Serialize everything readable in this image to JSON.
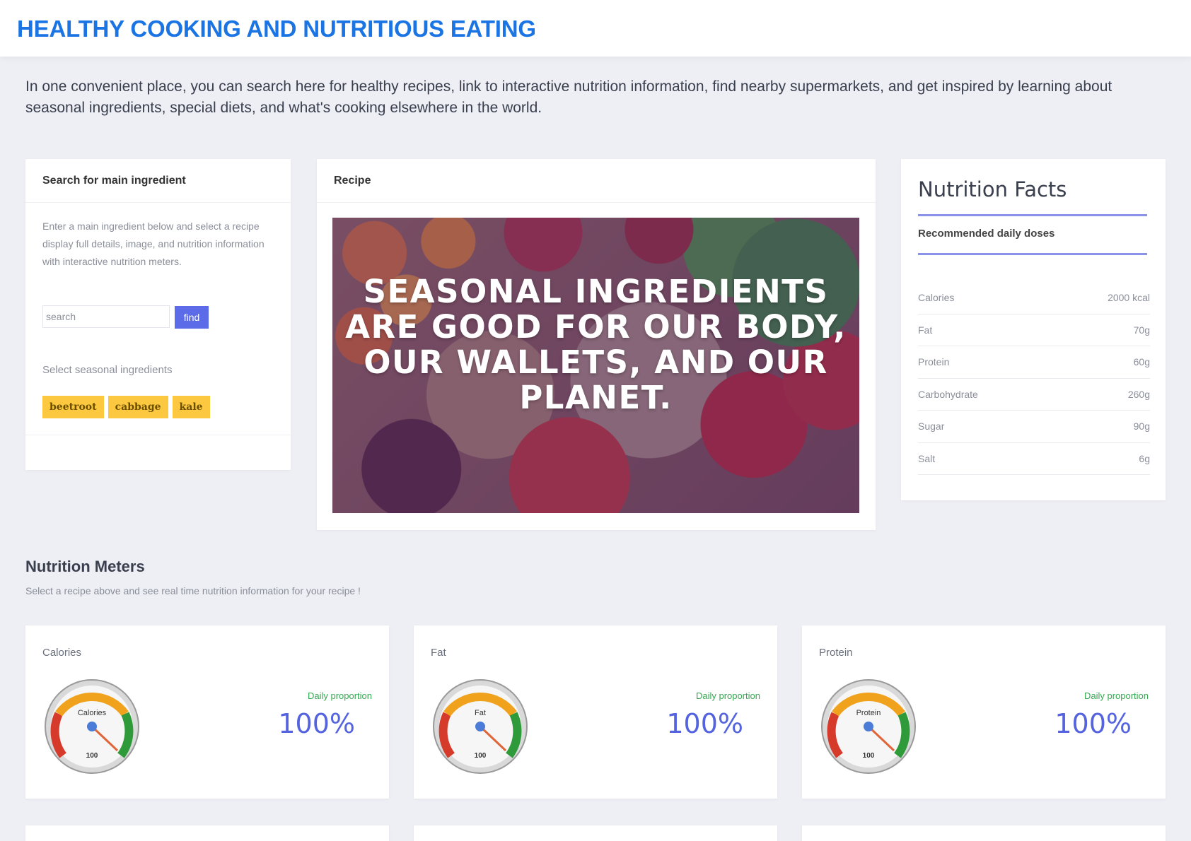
{
  "header": {
    "title": "HEALTHY COOKING AND NUTRITIOUS EATING"
  },
  "intro": "In one convenient place, you can search here for healthy recipes, link to interactive nutrition information, find nearby supermarkets, and get inspired by learning about seasonal ingredients, special diets, and what's cooking elsewhere in the world.",
  "search_card": {
    "title": "Search for main ingredient",
    "description": "Enter a main ingredient below and select a recipe display full details, image, and nutrition information with interactive nutrition meters.",
    "search_placeholder": "search",
    "find_label": "find",
    "seasonal_label": "Select seasonal ingredients",
    "chips": [
      "beetroot",
      "cabbage",
      "kale"
    ]
  },
  "recipe_card": {
    "title": "Recipe",
    "image_text": "SEASONAL INGREDIENTS ARE GOOD FOR OUR BODY, OUR WALLETS, AND OUR PLANET."
  },
  "facts_card": {
    "title": "Nutrition Facts",
    "subtitle": "Recommended daily doses",
    "rows": [
      {
        "label": "Calories",
        "value": "2000 kcal"
      },
      {
        "label": "Fat",
        "value": "70g"
      },
      {
        "label": "Protein",
        "value": "60g"
      },
      {
        "label": "Carbohydrate",
        "value": "260g"
      },
      {
        "label": "Sugar",
        "value": "90g"
      },
      {
        "label": "Salt",
        "value": "6g"
      }
    ]
  },
  "meters": {
    "title": "Nutrition Meters",
    "subtitle": "Select a recipe above and see real time nutrition information for your recipe !",
    "daily_label": "Daily proportion",
    "cards": [
      {
        "name": "Calories",
        "gauge_label": "Calories",
        "gauge_value": "100",
        "percent": "100%"
      },
      {
        "name": "Fat",
        "gauge_label": "Fat",
        "gauge_value": "100",
        "percent": "100%"
      },
      {
        "name": "Protein",
        "gauge_label": "Protein",
        "gauge_value": "100",
        "percent": "100%"
      }
    ]
  },
  "colors": {
    "brand_blue": "#1b74e4",
    "accent_purple": "#5c6ce8",
    "chip_yellow": "#fcc840",
    "daily_green": "#36a852"
  }
}
